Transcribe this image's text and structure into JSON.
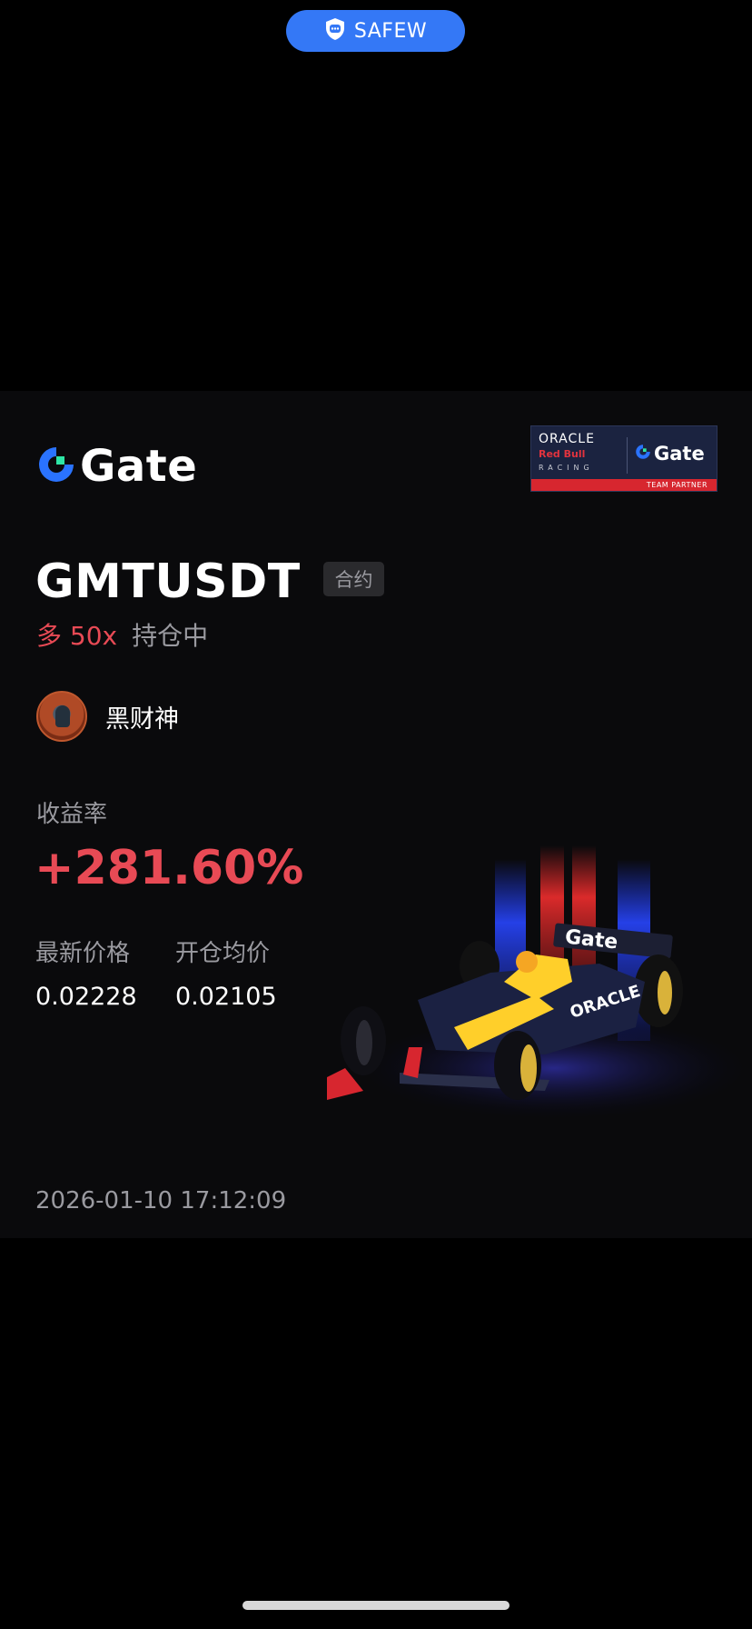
{
  "top_pill": {
    "label": "SAFEW",
    "icon": "chat-shield-icon",
    "color": "#3478f6"
  },
  "card": {
    "brand": {
      "name": "Gate",
      "icon": "gate-logo-icon"
    },
    "partner_badge": {
      "oracle": "ORACLE",
      "redbull": "Red Bull",
      "racing": "RACING",
      "gate": "Gate",
      "strip": "TEAM PARTNER"
    },
    "pair": "GMTUSDT",
    "tag": "合约",
    "direction": "多 50x",
    "status": "持仓中",
    "user": {
      "name": "黑财神",
      "avatar": "avatar-icon"
    },
    "roi_label": "收益率",
    "roi_value": "+281.60%",
    "latest_price": {
      "label": "最新价格",
      "value": "0.02228"
    },
    "entry_price": {
      "label": "开仓均价",
      "value": "0.02105"
    },
    "timestamp": "2026-01-10 17:12:09",
    "car_livery": "Gate"
  },
  "colors": {
    "accent_red": "#e84a55",
    "brand_blue": "#3478f6",
    "muted": "#9a9aa0"
  }
}
